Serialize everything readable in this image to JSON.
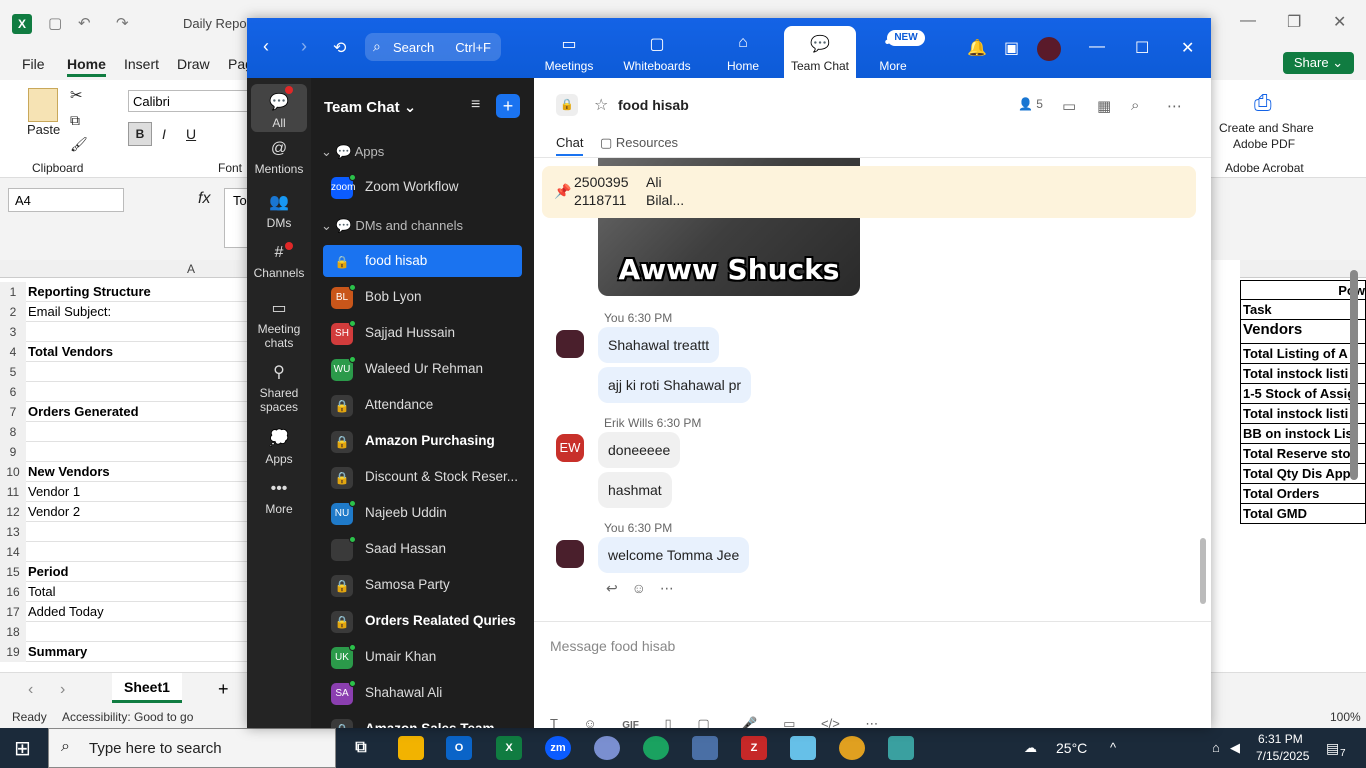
{
  "excel": {
    "doc_title": "Daily Report",
    "menu": [
      "File",
      "Home",
      "Insert",
      "Draw",
      "Pag"
    ],
    "share": "Share",
    "font_name": "Calibri",
    "paste": "Paste",
    "clipboard": "Clipboard",
    "font_group": "Font",
    "name_box": "A4",
    "fx": "fx",
    "formula_partial": "To",
    "adobe_line1": "Create and Share",
    "adobe_line2": "Adobe PDF",
    "adobe_group": "Adobe Acrobat",
    "col_a": "A",
    "rows": [
      {
        "n": "1",
        "a": "Reporting Structure",
        "bold": true
      },
      {
        "n": "2",
        "a": "Email Subject:",
        "bold": false
      },
      {
        "n": "3",
        "a": "",
        "bold": false
      },
      {
        "n": "4",
        "a": "Total Vendors",
        "bold": true
      },
      {
        "n": "5",
        "a": "",
        "bold": false
      },
      {
        "n": "6",
        "a": "",
        "bold": false
      },
      {
        "n": "7",
        "a": "Orders Generated",
        "bold": true
      },
      {
        "n": "8",
        "a": "",
        "bold": false
      },
      {
        "n": "9",
        "a": "",
        "bold": false
      },
      {
        "n": "10",
        "a": "New Vendors",
        "bold": true
      },
      {
        "n": "11",
        "a": "Vendor 1",
        "bold": false
      },
      {
        "n": "12",
        "a": "Vendor 2",
        "bold": false
      },
      {
        "n": "13",
        "a": "",
        "bold": false
      },
      {
        "n": "14",
        "a": "",
        "bold": false
      },
      {
        "n": "15",
        "a": "Period",
        "bold": true
      },
      {
        "n": "16",
        "a": "Total",
        "bold": false
      },
      {
        "n": "17",
        "a": "Added Today",
        "bold": false
      },
      {
        "n": "18",
        "a": "",
        "bold": false
      },
      {
        "n": "19",
        "a": "Summary",
        "bold": true
      }
    ],
    "right_cells": [
      "Pow",
      "Task",
      "Vendors",
      "Total Listing of A",
      "Total instock listi",
      "1-5 Stock of Assig",
      "Total instock listi",
      "BB on instock Lis",
      "Total Reserve sto",
      "Total Qty Dis App",
      "Total Orders",
      "Total GMD"
    ],
    "sheet_tab": "Sheet1",
    "status_ready": "Ready",
    "status_access": "Accessibility: Good to go",
    "zoom_pct": "100%"
  },
  "zoom": {
    "search_label": "Search",
    "search_shortcut": "Ctrl+F",
    "tabs": [
      "Meetings",
      "Whiteboards",
      "Home",
      "Team Chat",
      "More"
    ],
    "new_badge": "NEW",
    "rail": [
      "All",
      "Mentions",
      "DMs",
      "Channels",
      "Meeting chats",
      "Shared spaces",
      "Apps",
      "More"
    ],
    "sidebar_title": "Team Chat",
    "section_apps": "Apps",
    "section_dms": "DMs and channels",
    "items": [
      {
        "name": "Zoom Workflow",
        "avatar": "zoom",
        "color": "#0b5cff",
        "lock": false,
        "bold": false,
        "online": true
      },
      {
        "name": "food hisab",
        "avatar": "",
        "color": "",
        "lock": true,
        "bold": false,
        "online": false,
        "selected": true
      },
      {
        "name": "Bob Lyon",
        "avatar": "BL",
        "color": "#c9561a",
        "lock": false,
        "bold": false,
        "online": true
      },
      {
        "name": "Sajjad Hussain",
        "avatar": "SH",
        "color": "#d23c3c",
        "lock": false,
        "bold": false,
        "online": true
      },
      {
        "name": "Waleed Ur Rehman",
        "avatar": "WU",
        "color": "#2b9a4a",
        "lock": false,
        "bold": false,
        "online": true
      },
      {
        "name": "Attendance",
        "avatar": "",
        "color": "",
        "lock": true,
        "bold": false,
        "online": false
      },
      {
        "name": "Amazon Purchasing",
        "avatar": "",
        "color": "",
        "lock": true,
        "bold": true,
        "online": false
      },
      {
        "name": "Discount & Stock Reser...",
        "avatar": "",
        "color": "",
        "lock": true,
        "bold": false,
        "online": false
      },
      {
        "name": "Najeeb Uddin",
        "avatar": "NU",
        "color": "#1f7ac9",
        "lock": false,
        "bold": false,
        "online": true
      },
      {
        "name": "Saad Hassan",
        "avatar": "",
        "color": "#3a3a3a",
        "lock": false,
        "bold": false,
        "online": true
      },
      {
        "name": "Samosa Party",
        "avatar": "",
        "color": "",
        "lock": true,
        "bold": false,
        "online": false
      },
      {
        "name": "Orders Realated Quries",
        "avatar": "",
        "color": "",
        "lock": true,
        "bold": true,
        "online": false
      },
      {
        "name": "Umair Khan",
        "avatar": "UK",
        "color": "#2b9a4a",
        "lock": false,
        "bold": false,
        "online": true
      },
      {
        "name": "Shahawal Ali",
        "avatar": "SA",
        "color": "#8b3fb0",
        "lock": false,
        "bold": false,
        "online": true
      },
      {
        "name": "Amazon Sales Team",
        "avatar": "",
        "color": "",
        "lock": true,
        "bold": true,
        "online": false
      }
    ],
    "channel_name": "food hisab",
    "member_count": "5",
    "tab_chat": "Chat",
    "tab_resources": "Resources",
    "pinned": [
      {
        "num": "2500395",
        "name": "Ali"
      },
      {
        "num": "2118711",
        "name": "Bilal..."
      }
    ],
    "gif_caption": "Awww Shucks",
    "messages": [
      {
        "sender": "You",
        "time": "6:30 PM",
        "lines": [
          "Shahawal treattt",
          "ajj ki roti Shahawal pr"
        ],
        "avatar": ""
      },
      {
        "sender": "Erik Wills",
        "time": "6:30 PM",
        "lines": [
          "doneeeee",
          "hashmat"
        ],
        "avatar": "EW"
      },
      {
        "sender": "You",
        "time": "6:30 PM",
        "lines": [
          "welcome Tomma Jee"
        ],
        "avatar": ""
      }
    ],
    "compose_placeholder": "Message food hisab"
  },
  "taskbar": {
    "search_placeholder": "Type here to search",
    "weather": "25°C",
    "time": "6:31 PM",
    "date": "7/15/2025",
    "notif_count": "7"
  }
}
